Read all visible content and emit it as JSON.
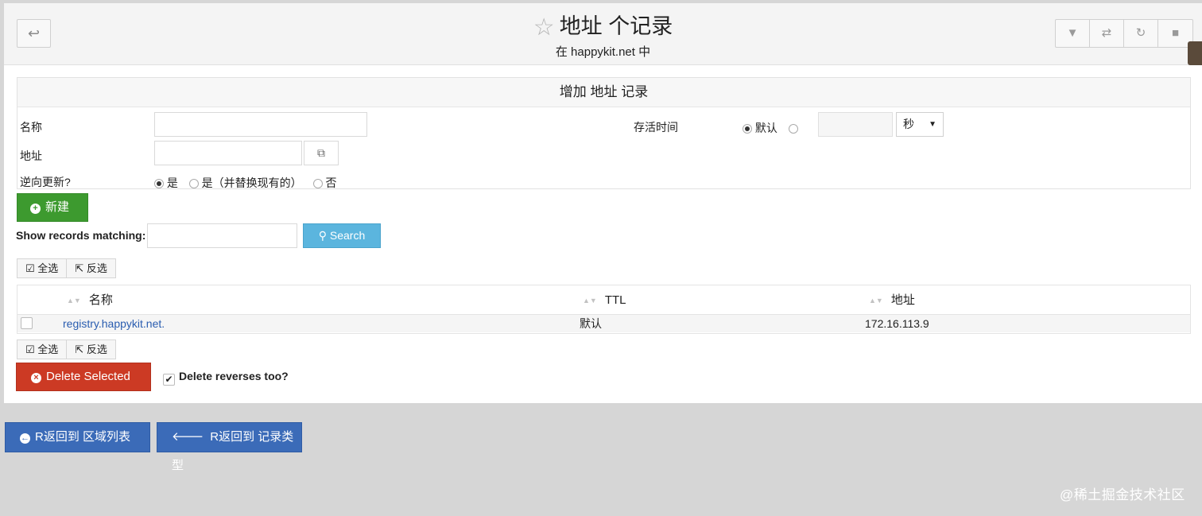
{
  "header": {
    "title": "地址 个记录",
    "subtitle": "在 happykit.net 中",
    "back_icon": "↩",
    "star_icon": "☆",
    "tools": [
      "filter-icon",
      "swap-icon",
      "refresh-icon",
      "stop-icon"
    ]
  },
  "form": {
    "heading": "增加 地址 记录",
    "name_label": "名称",
    "address_label": "地址",
    "reverse_label": "逆向更新?",
    "reverse_options": [
      "是",
      "是（并替换现有的）",
      "否"
    ],
    "ttl_label": "存活时间",
    "ttl_default": "默认",
    "ttl_unit": "秒"
  },
  "actions": {
    "new_label": "新建",
    "search_label": "Show records matching:",
    "search_button": "Search",
    "select_all": "全选",
    "invert": "反选",
    "delete_selected": "Delete Selected",
    "delete_reverses": "Delete reverses too?"
  },
  "table": {
    "columns": [
      "名称",
      "TTL",
      "地址"
    ],
    "rows": [
      {
        "name": "registry.happykit.net.",
        "ttl": "默认",
        "address": "172.16.113.9"
      }
    ]
  },
  "footer": {
    "back_zones": "R返回到 区域列表",
    "back_types": "R返回到 记录类型",
    "watermark": "@稀土掘金技术社区"
  },
  "colors": {
    "green": "#3d9a2f",
    "red": "#cc3a24",
    "blue": "#3b6bb8",
    "search_blue": "#5bb5de"
  }
}
